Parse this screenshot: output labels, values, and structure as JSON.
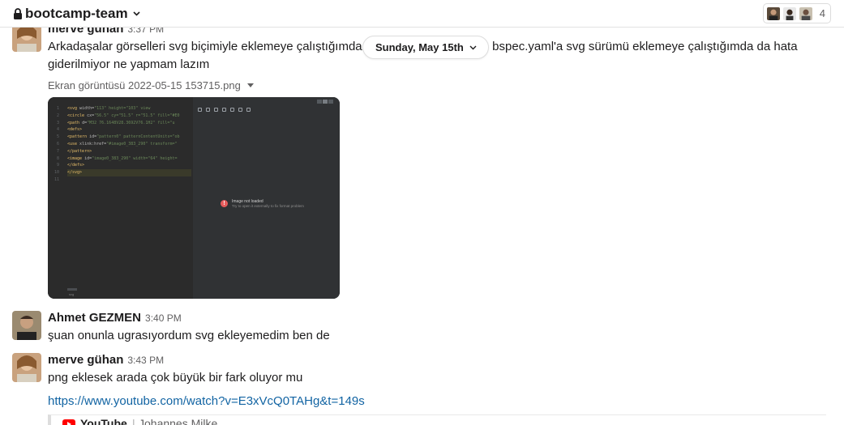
{
  "channel": {
    "name": "bootcamp-team",
    "member_count": "4"
  },
  "date_divider": "Sunday, May 15th",
  "messages": [
    {
      "author": "merve gühan",
      "time": "3:37 PM",
      "text_part1": "Arkadaşalar görselleri svg biçimiyle eklemeye çalıştığımda b",
      "text_part2": "bspec.yaml'a svg sürümü eklemeye çalıştığımda da hata",
      "text_line2": "giderilmiyor ne yapmam lazım",
      "file_name": "Ekran görüntüsü 2022-05-15 153715.png",
      "attachment": {
        "code_lines": [
          {
            "n": "1",
            "tag": "<svg",
            "attr": " width=",
            "val": "\"113\" height=\"103\" view"
          },
          {
            "n": "2",
            "tag": "<circle",
            "attr": " cx=",
            "val": "\"56.5\" cy=\"51.5\" r=\"51.5\" fill=\"#E0"
          },
          {
            "n": "3",
            "tag": "<path",
            "attr": " d=",
            "val": "\"M32 76.1648V28.3692V76.1H2\" fill=\"u"
          },
          {
            "n": "4",
            "tag": "<defs>",
            "attr": "",
            "val": ""
          },
          {
            "n": "5",
            "tag": "<pattern",
            "attr": " id=",
            "val": "\"pattern0\" patternContentUnits=\"ob"
          },
          {
            "n": "6",
            "tag": "<use",
            "attr": " xlink:href=",
            "val": "\"#image0_383_290\" transform=\""
          },
          {
            "n": "7",
            "tag": "</pattern>",
            "attr": "",
            "val": ""
          },
          {
            "n": "8",
            "tag": "<image",
            "attr": " id=",
            "val": "\"image0_383_290\" width=\"64\" height="
          },
          {
            "n": "9",
            "tag": "</defs>",
            "attr": "",
            "val": ""
          },
          {
            "n": "10",
            "tag": "</svg>",
            "attr": "",
            "val": ""
          },
          {
            "n": "11",
            "tag": "",
            "attr": "",
            "val": ""
          }
        ],
        "bottom_label": "svg",
        "error_title": "Image not loaded",
        "error_sub": "Try to open it externally to fix format problem"
      }
    },
    {
      "author": "Ahmet GEZMEN",
      "time": "3:40 PM",
      "text": "şuan onunla ugrasıyordum svg ekleyemedim ben de"
    },
    {
      "author": "merve gühan",
      "time": "3:43 PM",
      "text": "png eklesek arada çok büyük bir fark oluyor mu",
      "link": "https://www.youtube.com/watch?v=E3xVcQ0TAHg&t=149s",
      "unfurl": {
        "source": "YouTube",
        "separator": "|",
        "author": "Johannes Milke"
      }
    }
  ],
  "colors": {
    "link": "#1264a3",
    "youtube": "#ff0000",
    "error": "#e55b5b"
  }
}
